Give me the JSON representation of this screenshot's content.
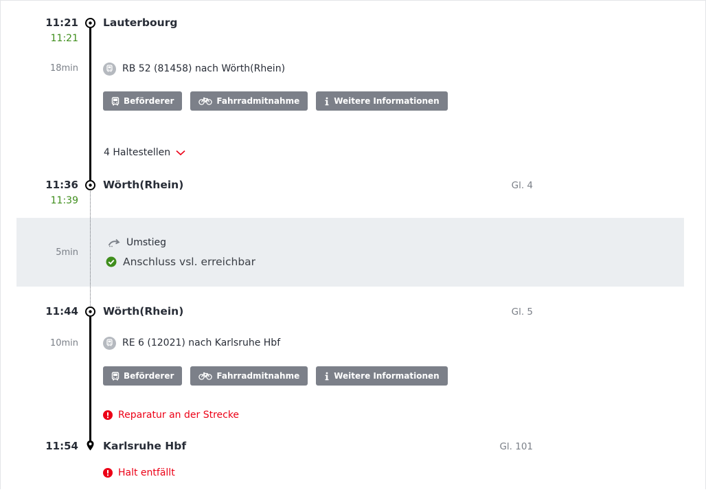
{
  "colors": {
    "accent_red": "#ec0016",
    "realtime_green": "#3f8e1c",
    "button_gray": "#7c8089",
    "transfer_bg": "#ebeef1"
  },
  "segments": [
    {
      "dep_time": "11:21",
      "dep_realtime": "11:21",
      "dep_station": "Lauterbourg",
      "duration": "18min",
      "train": "RB 52 (81458) nach Wörth(Rhein)",
      "train_icon": "train-icon",
      "buttons": [
        "Beförderer",
        "Fahrradmitnahme",
        "Weitere Informationen"
      ],
      "stops_toggle": "4 Haltestellen",
      "arr_time": "11:36",
      "arr_realtime": "11:39",
      "arr_station": "Wörth(Rhein)",
      "arr_platform": "Gl. 4"
    },
    {
      "dep_time": "11:44",
      "dep_station": "Wörth(Rhein)",
      "dep_platform": "Gl. 5",
      "duration": "10min",
      "train": "RE 6 (12021) nach Karlsruhe Hbf",
      "train_icon": "train-icon",
      "buttons": [
        "Beförderer",
        "Fahrradmitnahme",
        "Weitere Informationen"
      ],
      "notice": "Reparatur an der Strecke",
      "arr_time": "11:54",
      "arr_station": "Karlsruhe Hbf",
      "arr_platform": "Gl. 101",
      "arr_notice": "Halt entfällt"
    }
  ],
  "transfer": {
    "duration": "5min",
    "label": "Umstieg",
    "status": "Anschluss vsl. erreichbar"
  }
}
